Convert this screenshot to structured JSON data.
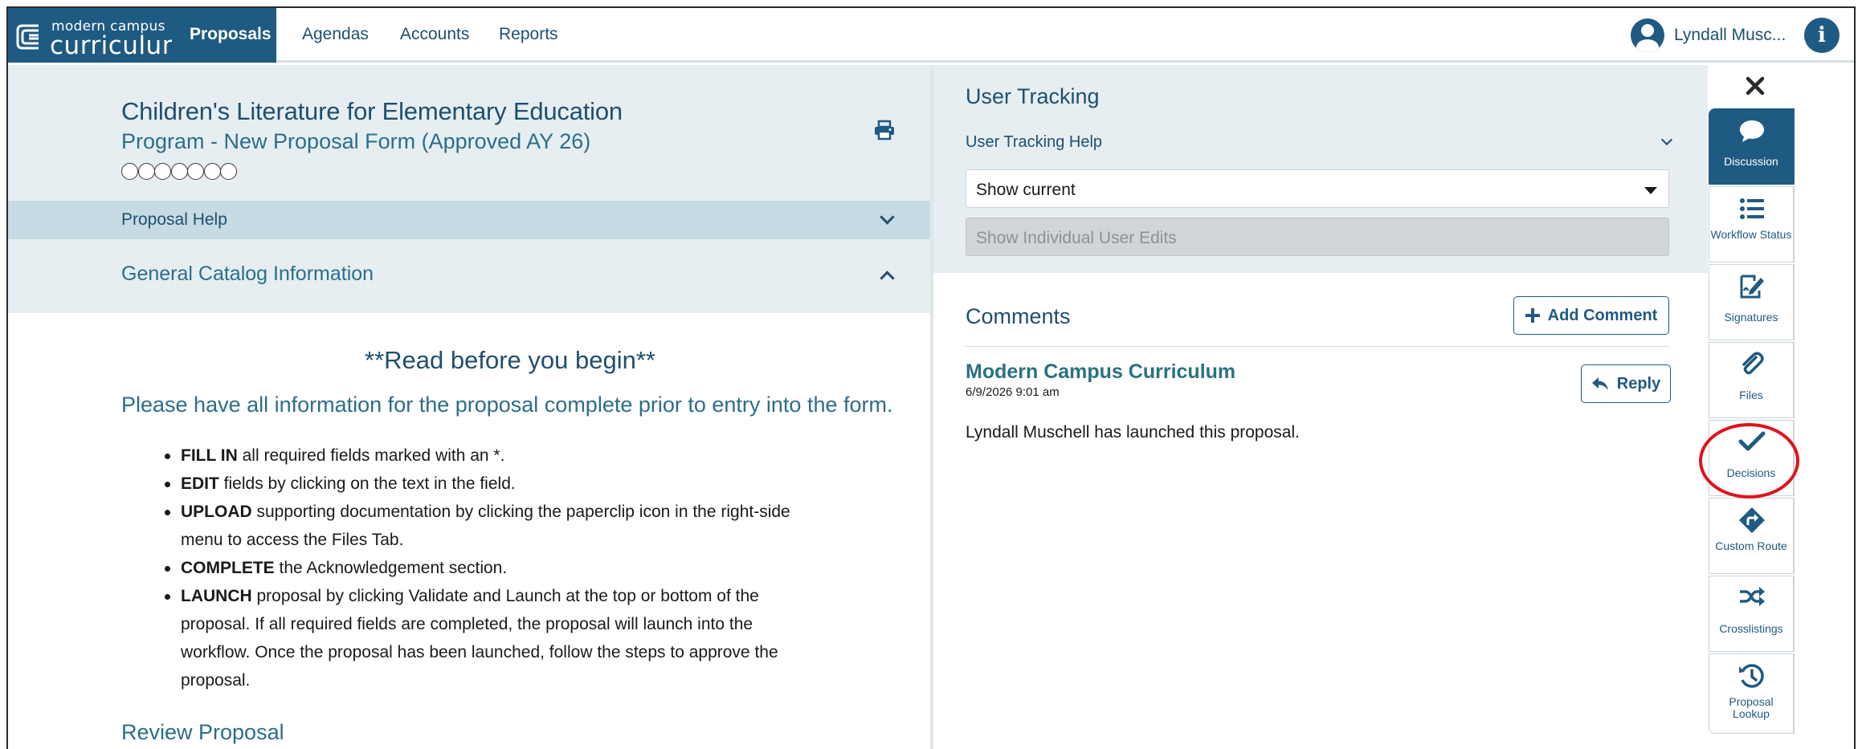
{
  "app": {
    "logo_small": "modern campus",
    "logo_big": "curriculum",
    "logo_tm": "™"
  },
  "nav": {
    "tabs": [
      {
        "label": "Proposals",
        "active": true
      },
      {
        "label": "Agendas",
        "active": false
      },
      {
        "label": "Accounts",
        "active": false
      },
      {
        "label": "Reports",
        "active": false
      }
    ],
    "user_name": "Lyndall Musc...",
    "user_icon": "user-circle-icon",
    "info_icon": "info-icon"
  },
  "proposal": {
    "title": "Children's Literature for Elementary Education",
    "subtitle": "Program - New Proposal Form (Approved AY 26)",
    "progress_steps_total": 7,
    "progress_steps_done": 0,
    "help_label": "Proposal Help",
    "section_label": "General Catalog Information",
    "read_heading": "**Read before you begin**",
    "please_text": "Please have all information for the proposal complete prior to entry into the form.",
    "instructions": [
      {
        "bold": "FILL IN",
        "text": " all required fields marked with an *."
      },
      {
        "bold": "EDIT",
        "text": " fields by clicking on the text in the field."
      },
      {
        "bold": "UPLOAD",
        "text": " supporting documentation by clicking the paperclip icon in the right-side menu to access the Files Tab."
      },
      {
        "bold": "COMPLETE",
        "text": " the Acknowledgement section."
      },
      {
        "bold": "LAUNCH",
        "text": " proposal by clicking Validate and Launch at the top or bottom of the proposal.  If all required fields are completed, the proposal will launch into the workflow. Once the proposal has been launched, follow the steps to approve the proposal."
      }
    ],
    "review_label": "Review Proposal"
  },
  "user_tracking": {
    "title": "User Tracking",
    "help_label": "User Tracking Help",
    "select_value": "Show current",
    "individual_edits": "Show Individual User Edits"
  },
  "comments": {
    "title": "Comments",
    "add_label": "Add Comment",
    "items": [
      {
        "author": "Modern Campus Curriculum",
        "date": "6/9/2026 9:01 am",
        "text": "Lyndall Muschell has launched this proposal.",
        "reply_label": "Reply"
      }
    ]
  },
  "rail": {
    "items": [
      {
        "label": "Discussion",
        "icon": "chat-bubble-icon",
        "active": true
      },
      {
        "label": "Workflow Status",
        "icon": "list-icon",
        "active": false
      },
      {
        "label": "Signatures",
        "icon": "signature-icon",
        "active": false
      },
      {
        "label": "Files",
        "icon": "paperclip-icon",
        "active": false
      },
      {
        "label": "Decisions",
        "icon": "checkmark-icon",
        "active": false,
        "highlighted": true
      },
      {
        "label": "Custom Route",
        "icon": "route-diamond-icon",
        "active": false
      },
      {
        "label": "Crosslistings",
        "icon": "shuffle-icon",
        "active": false
      },
      {
        "label": "Proposal Lookup",
        "icon": "history-icon",
        "active": false
      }
    ]
  },
  "colors": {
    "brand": "#1f5a82",
    "panel": "#e6eef2",
    "help_bar": "#c6dbe3",
    "highlight": "#e0121e"
  }
}
